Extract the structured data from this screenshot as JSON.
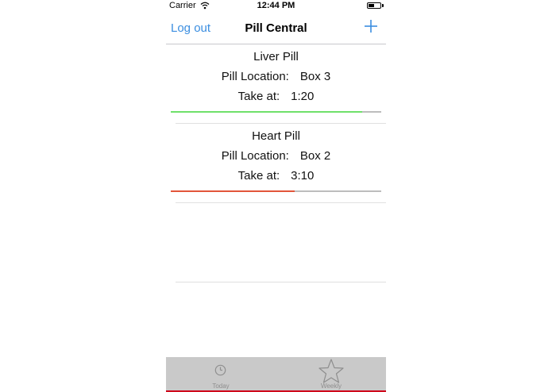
{
  "status_bar": {
    "carrier": "Carrier",
    "time": "12:44 PM",
    "battery_level": 0.5
  },
  "nav": {
    "left_button": "Log out",
    "title": "Pill Central",
    "right_button_icon": "plus-icon"
  },
  "pills": [
    {
      "name": "Liver Pill",
      "location_label": "Pill Location:",
      "location_value": "Box 3",
      "time_label": "Take at:",
      "time_value": "1:20",
      "progress": 0.91,
      "progress_color": "#6fe06a"
    },
    {
      "name": "Heart Pill",
      "location_label": "Pill Location:",
      "location_value": "Box 2",
      "time_label": "Take at:",
      "time_value": "3:10",
      "progress": 0.59,
      "progress_color": "#e2553a"
    }
  ],
  "tabs": [
    {
      "label": "Today",
      "icon": "clock-icon"
    },
    {
      "label": "Weekly",
      "icon": "star-icon"
    }
  ],
  "colors": {
    "accent": "#3b8ee0",
    "tab_bar_bg": "#c9c9c9",
    "tab_bar_bottom_border": "#d0021b"
  }
}
